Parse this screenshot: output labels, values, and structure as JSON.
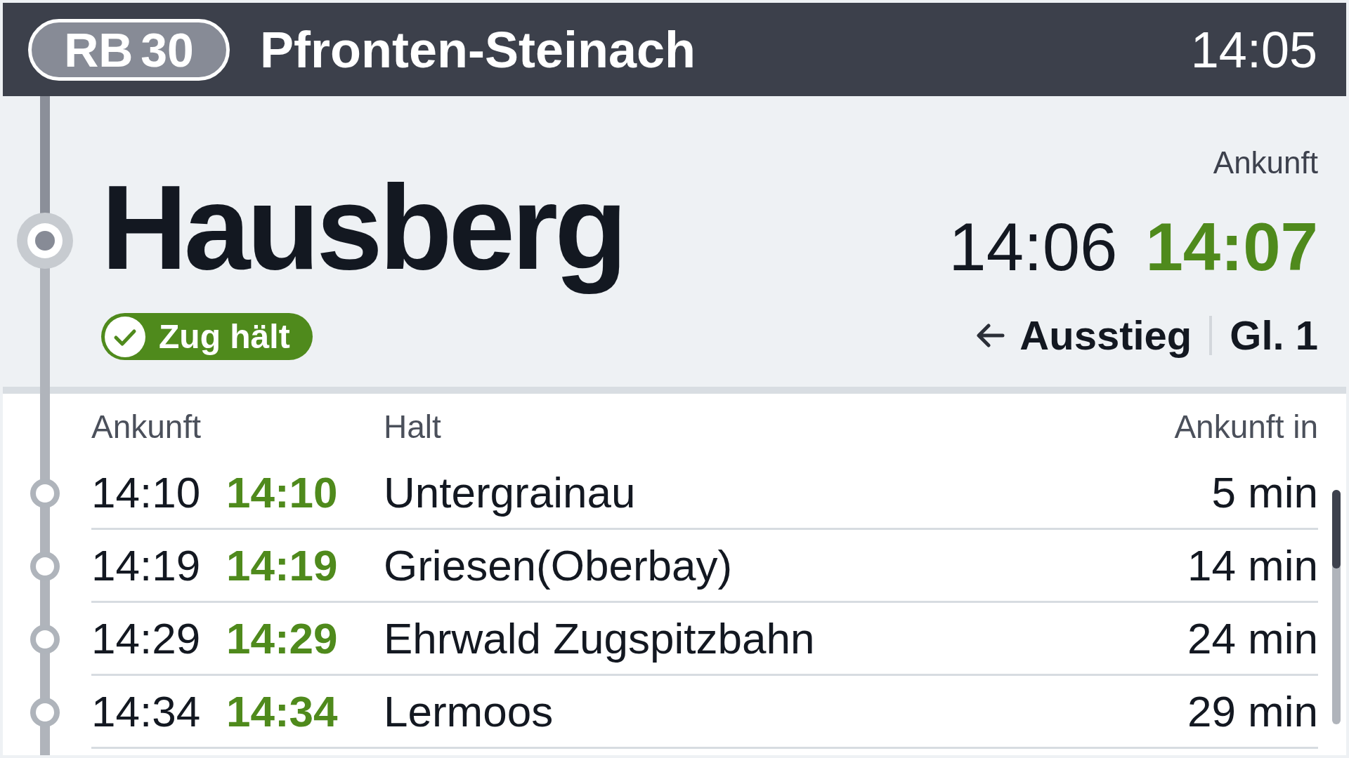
{
  "header": {
    "line": "RB 30",
    "destination": "Pfronten-Steinach",
    "clock": "14:05"
  },
  "current_stop": {
    "name": "Hausberg",
    "status": "Zug hält",
    "arrival_label": "Ankunft",
    "scheduled": "14:06",
    "expected": "14:07",
    "exit": "Ausstieg",
    "track": "Gl. 1"
  },
  "upcoming": {
    "columns": [
      "Ankunft",
      "Halt",
      "Ankunft in"
    ],
    "rows": [
      {
        "scheduled": "14:10",
        "expected": "14:10",
        "stop": "Untergrainau",
        "arrival_in": "5 min"
      },
      {
        "scheduled": "14:19",
        "expected": "14:19",
        "stop": "Griesen(Oberbay)",
        "arrival_in": "14 min"
      },
      {
        "scheduled": "14:29",
        "expected": "14:29",
        "stop": "Ehrwald Zugspitzbahn",
        "arrival_in": "24 min"
      },
      {
        "scheduled": "14:34",
        "expected": "14:34",
        "stop": "Lermoos",
        "arrival_in": "29 min"
      }
    ]
  }
}
